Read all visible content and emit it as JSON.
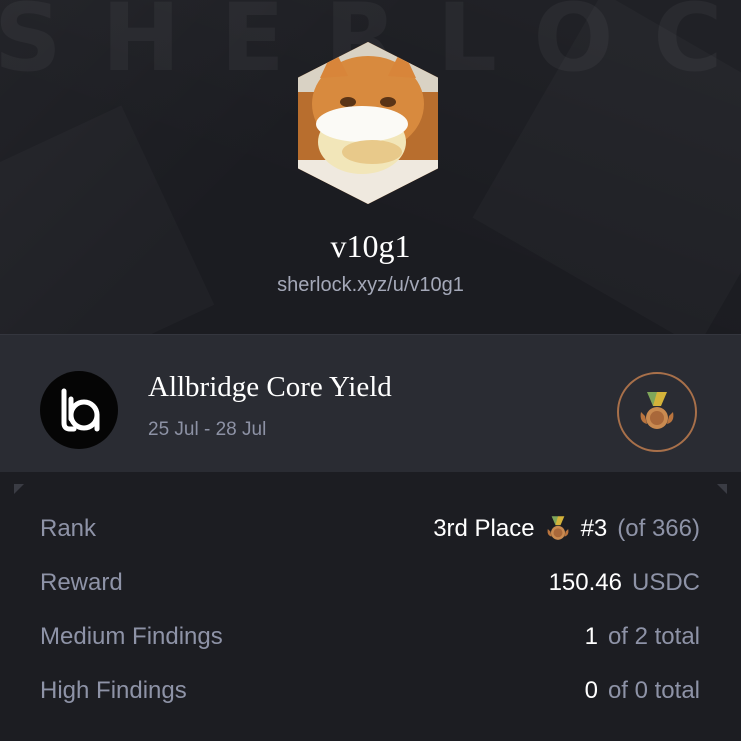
{
  "profile": {
    "watermark": "SHERLOCK",
    "username": "v10g1",
    "url": "sherlock.xyz/u/v10g1",
    "avatar_alt": "orange cat eating a cream pie"
  },
  "contest": {
    "name": "Allbridge Core Yield",
    "dates": "25 Jul - 28 Jul",
    "logo_icon": "allbridge-logo-icon",
    "medal_icon": "bronze-medal-icon"
  },
  "stats": {
    "rank": {
      "label": "Rank",
      "place": "3rd Place",
      "number": "#3",
      "of_total": "(of 366)"
    },
    "reward": {
      "label": "Reward",
      "amount": "150.46",
      "currency": "USDC"
    },
    "medium": {
      "label": "Medium Findings",
      "count": "1",
      "of_total": "of 2 total"
    },
    "high": {
      "label": "High Findings",
      "count": "0",
      "of_total": "of 0 total"
    }
  },
  "colors": {
    "background": "#1e1f25",
    "contest_band": "#2a2c33",
    "muted_text": "#8e93a7",
    "medal_ring": "#a8704a",
    "bronze": "#c98a50"
  }
}
